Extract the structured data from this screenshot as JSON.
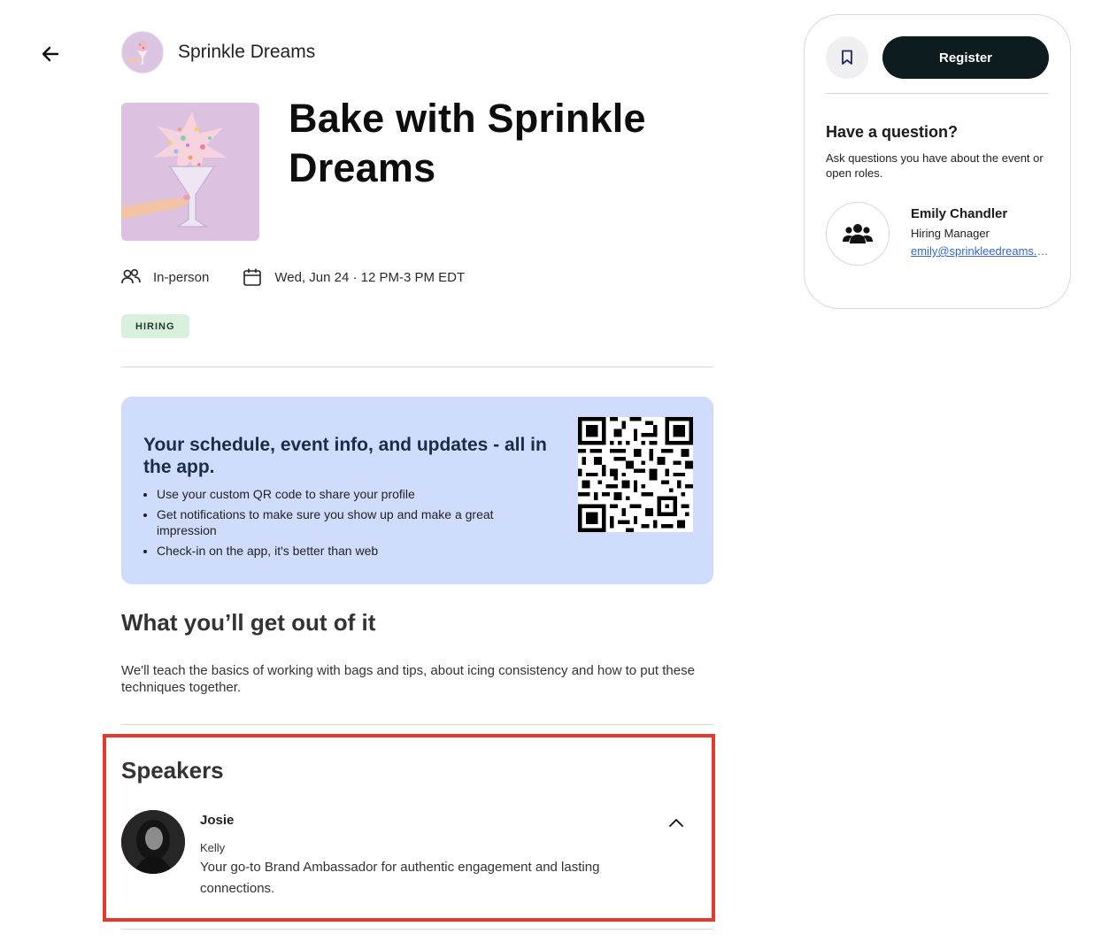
{
  "header": {
    "back_icon": "arrow-left-icon",
    "org_name": "Sprinkle Dreams"
  },
  "event": {
    "title": "Bake with Sprinkle Dreams",
    "format": "In-person",
    "datetime": "Wed, Jun 24 · 12 PM-3 PM EDT",
    "tag": "HIRING"
  },
  "app_promo": {
    "title": "Your schedule, event info, and updates - all in the app.",
    "bullets": [
      "Use your custom QR code to share your profile",
      "Get notifications to make sure you show up and make a great impression",
      "Check-in on the app, it's better than web"
    ]
  },
  "about": {
    "heading": "What you’ll get out of it",
    "description": "We'll teach the basics of working with bags and tips, about icing consistency and how to put these techniques together."
  },
  "speakers": {
    "heading": "Speakers",
    "items": [
      {
        "name": "Josie",
        "subtitle": "Kelly",
        "bio": "Your go-to Brand Ambassador for authentic engagement and lasting connections."
      }
    ]
  },
  "sidebar": {
    "register_label": "Register",
    "question_title": "Have a question?",
    "question_desc": "Ask questions you have about the event or open roles.",
    "contact": {
      "name": "Emily Chandler",
      "role": "Hiring Manager",
      "email": "emily@sprinkleedreams.com"
    }
  },
  "colors": {
    "accent_dark": "#0c1c1e",
    "promo_bg": "#cfdcfb",
    "tag_bg": "#d9f0de",
    "highlight_border": "#e5392d",
    "link": "#3466e0"
  }
}
